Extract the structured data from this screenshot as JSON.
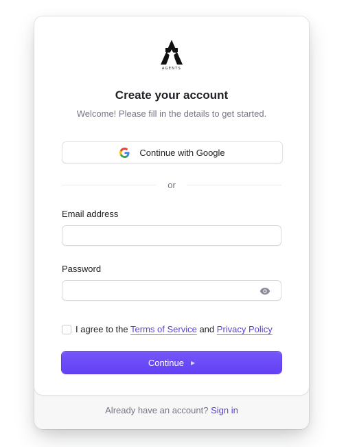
{
  "brand": {
    "logo_text": "AGENTS",
    "accent_color": "#6c47ff"
  },
  "header": {
    "title": "Create your account",
    "subtitle": "Welcome! Please fill in the details to get started."
  },
  "social": {
    "google_label": "Continue with Google",
    "icon": "google-icon"
  },
  "divider": {
    "text": "or"
  },
  "form": {
    "email": {
      "label": "Email address",
      "value": "",
      "placeholder": ""
    },
    "password": {
      "label": "Password",
      "value": "",
      "placeholder": "",
      "toggle_icon": "eye-icon"
    },
    "terms": {
      "prefix": "I agree to the",
      "terms_link": "Terms of Service",
      "conjunction": "and",
      "privacy_link": "Privacy Policy",
      "checked": false
    },
    "submit_label": "Continue",
    "submit_icon": "caret-right-icon"
  },
  "footer": {
    "text": "Already have an account?",
    "link": "Sign in"
  }
}
